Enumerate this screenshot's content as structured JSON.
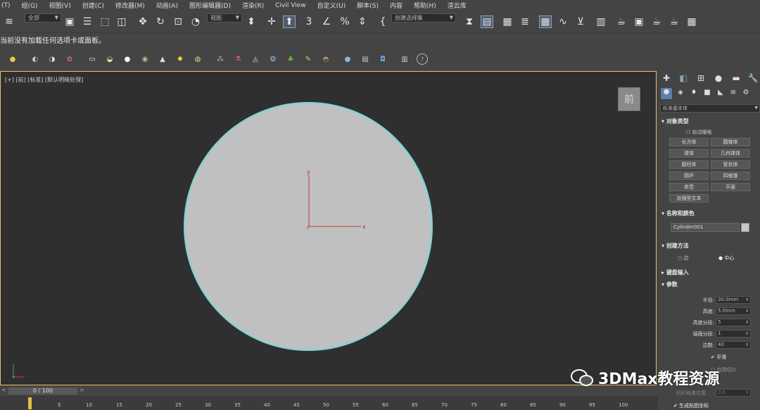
{
  "menubar": {
    "items": [
      "(T)",
      "组(G)",
      "视图(V)",
      "创建(C)",
      "修改器(M)",
      "动画(A)",
      "图形编辑器(D)",
      "渲染(R)",
      "Civil View",
      "自定义(U)",
      "脚本(S)",
      "内容",
      "帮助(H)",
      "渲云库"
    ]
  },
  "toolbar": {
    "filter_label": "全部",
    "view_label": "视图",
    "selection_set_label": "创建选择集"
  },
  "prompt": {
    "text": "当前没有加载任何选项卡或面板。"
  },
  "viewport": {
    "label": "[+] [前] [标准] [默认明暗处理]",
    "viewcube_label": "前",
    "axis_y": "y",
    "axis_x": "x",
    "axis_z": "z"
  },
  "command_panel": {
    "category_dropdown": "标准基本体",
    "object_type": {
      "header": "对象类型",
      "autogrid": "自动栅格",
      "buttons": [
        "长方体",
        "圆锥体",
        "球体",
        "几何球体",
        "圆柱体",
        "管状体",
        "圆环",
        "四棱锥",
        "茶壶",
        "平面",
        "加强型文本"
      ]
    },
    "name_color": {
      "header": "名称和颜色",
      "name_value": "Cylinder001"
    },
    "creation_method": {
      "header": "创建方法",
      "option_edge": "边",
      "option_center": "中心"
    },
    "keyboard_entry": {
      "header": "键盘输入"
    },
    "parameters": {
      "header": "参数",
      "radius_label": "半径:",
      "radius": "30.0mm",
      "height_label": "高度:",
      "height": "5.0mm",
      "height_segments_label": "高度分段:",
      "height_segments": "5",
      "cap_segments_label": "端面分段:",
      "cap_segments": "1",
      "sides_label": "边数:",
      "sides": "40",
      "smooth_label": "平滑",
      "slice_label": "启用切片",
      "slice_to_label": "切片结束位置:",
      "slice_to": "0.0",
      "gen_map_label": "生成贴图坐标"
    }
  },
  "timeline": {
    "frame_label": "0 / 100",
    "ticks": [
      "5",
      "10",
      "15",
      "20",
      "25",
      "30",
      "35",
      "40",
      "45",
      "50",
      "55",
      "60",
      "65",
      "70",
      "75",
      "80",
      "85",
      "90",
      "95",
      "100"
    ]
  },
  "watermark": {
    "text": "3DMax教程资源"
  }
}
